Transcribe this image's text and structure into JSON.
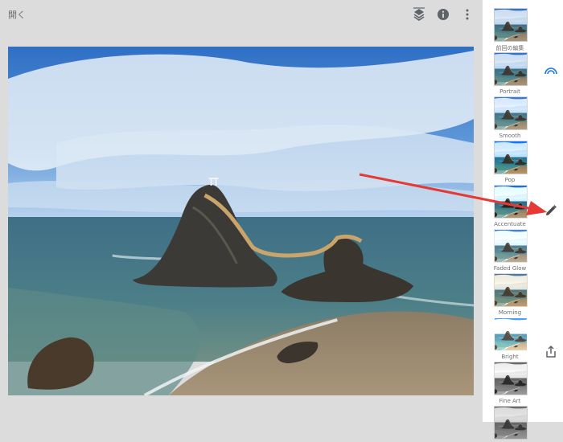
{
  "topbar": {
    "open_label": "開く",
    "icons": [
      "layers-stack-icon",
      "info-icon",
      "more-vertical-icon"
    ]
  },
  "looks": [
    {
      "label": "前回の編集",
      "filter": "none"
    },
    {
      "label": "Portrait",
      "filter": "saturate(1.1)"
    },
    {
      "label": "Smooth",
      "filter": "brightness(1.05)"
    },
    {
      "label": "Pop",
      "filter": "saturate(1.5) contrast(1.1)"
    },
    {
      "label": "Accentuate",
      "filter": "contrast(1.3)"
    },
    {
      "label": "Faded Glow",
      "filter": "brightness(1.15) saturate(0.8)"
    },
    {
      "label": "Morning",
      "filter": "sepia(0.35) saturate(1.3)"
    },
    {
      "label": "Bright",
      "filter": "brightness(1.4)"
    },
    {
      "label": "Fine Art",
      "filter": "grayscale(1) contrast(1.2)"
    },
    {
      "label": "",
      "filter": "grayscale(1)"
    }
  ],
  "side_icons": [
    "looks-rainbow-icon",
    "edit-pencil-icon",
    "export-share-icon"
  ],
  "colors": {
    "accent_blue": "#1a73e8",
    "annotation_arrow": "#e53935"
  }
}
